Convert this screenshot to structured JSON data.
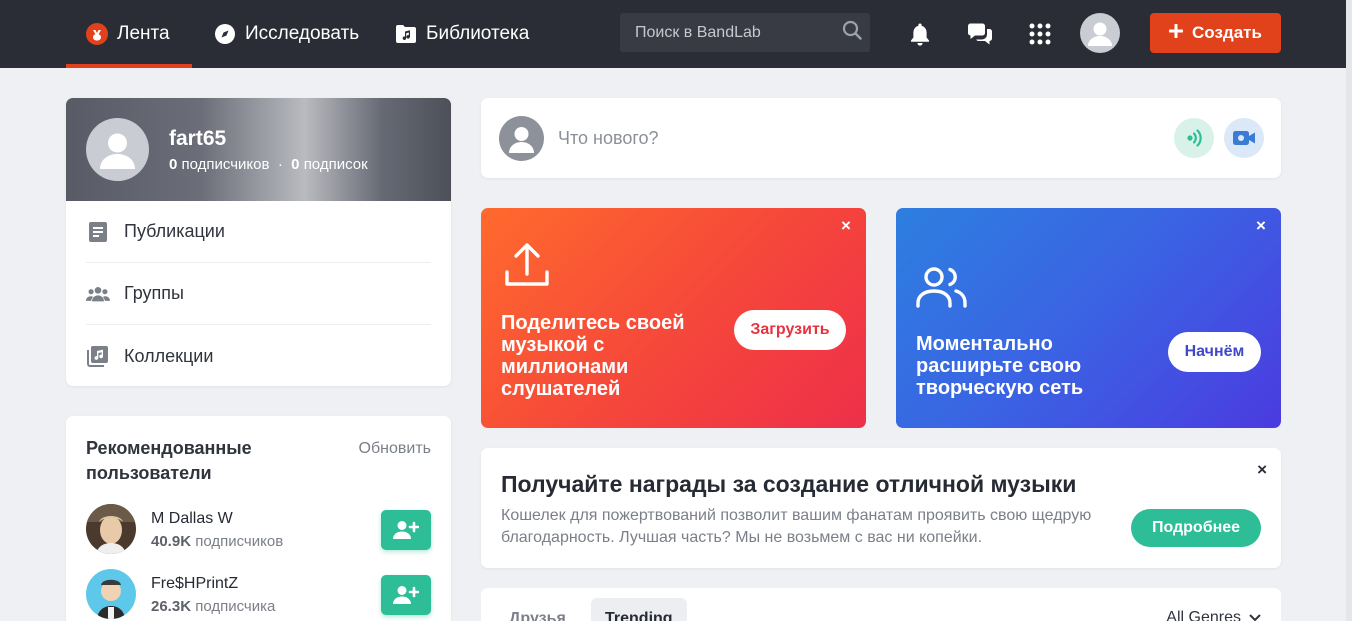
{
  "colors": {
    "accent": "#e2421b",
    "topbar": "#2a2d35",
    "green": "#2dbd97",
    "background": "#eef0f3"
  },
  "nav": {
    "items": [
      {
        "label": "Лента",
        "icon": "bandlab-logo-icon",
        "active": true
      },
      {
        "label": "Исследовать",
        "icon": "compass-icon"
      },
      {
        "label": "Библиотека",
        "icon": "music-folder-icon"
      }
    ],
    "search_placeholder": "Поиск в BandLab",
    "create_label": "Создать"
  },
  "profile": {
    "username": "fart65",
    "followers_count": "0",
    "followers_label": "подписчиков",
    "following_count": "0",
    "following_label": "подписок",
    "menu": [
      {
        "label": "Публикации",
        "icon": "posts-icon"
      },
      {
        "label": "Группы",
        "icon": "groups-icon"
      },
      {
        "label": "Коллекции",
        "icon": "collections-icon"
      }
    ]
  },
  "recommended": {
    "title": "Рекомендованные пользователи",
    "refresh_label": "Обновить",
    "users": [
      {
        "name": "M Dallas W",
        "count": "40.9K",
        "label": "подписчиков"
      },
      {
        "name": "Fre$HPrintZ",
        "count": "26.3K",
        "label": "подписчика"
      }
    ]
  },
  "composer": {
    "placeholder": "Что нового?"
  },
  "promos": {
    "upload": {
      "text": "Поделитесь своей музыкой с миллионами слушателей",
      "button": "Загрузить",
      "close": "×"
    },
    "network": {
      "text": "Моментально расширьте свою творческую сеть",
      "button": "Начнём",
      "close": "×"
    }
  },
  "rewards": {
    "title": "Получайте награды за создание отличной музыки",
    "description": "Кошелек для пожертвований позволит вашим фанатам проявить свою щедрую благодарность. Лучшая часть? Мы не возьмем с вас ни копейки.",
    "button": "Подробнее",
    "close": "×"
  },
  "feed": {
    "tabs": [
      {
        "label": "Друзья"
      },
      {
        "label": "Trending",
        "active": true
      }
    ],
    "genre_label": "All Genres"
  }
}
